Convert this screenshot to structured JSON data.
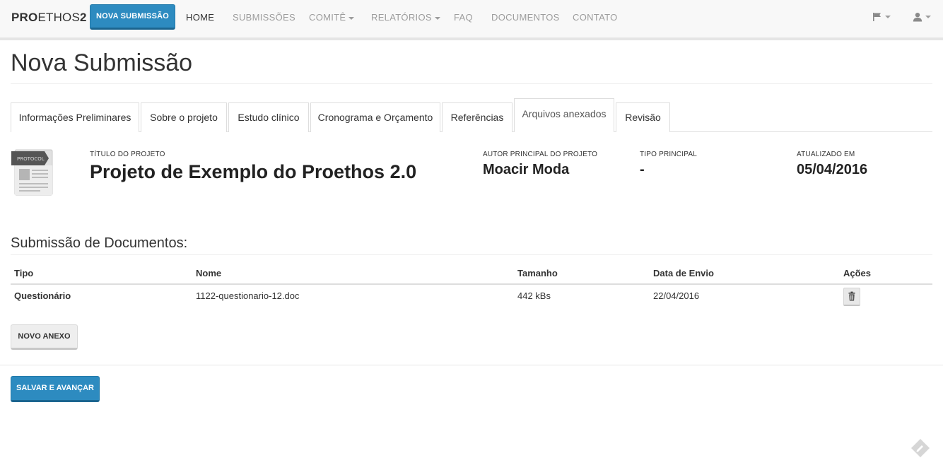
{
  "navbar": {
    "brand_bold": "PRO",
    "brand_light": "ETHOS",
    "brand_suffix": "2",
    "new_submission": "NOVA SUBMISSÃO",
    "items": [
      {
        "label": "HOME",
        "active": true
      },
      {
        "label": "SUBMISSÕES"
      },
      {
        "label": "COMITÊ"
      },
      {
        "label": "RELATÓRIOS"
      },
      {
        "label": "FAQ"
      },
      {
        "label": "DOCUMENTOS"
      },
      {
        "label": "CONTATO"
      }
    ],
    "right_icons": [
      "flag-icon",
      "user-icon"
    ]
  },
  "page": {
    "title": "Nova Submissão"
  },
  "tabs": [
    {
      "label": "Informações Preliminares"
    },
    {
      "label": "Sobre o projeto"
    },
    {
      "label": "Estudo clínico"
    },
    {
      "label": "Cronograma e Orçamento"
    },
    {
      "label": "Referências"
    },
    {
      "label": "Arquivos anexados",
      "active": true
    },
    {
      "label": "Revisão"
    }
  ],
  "project": {
    "icon_text": "PROTOCOL",
    "title_label": "TÍTULO DO PROJETO",
    "title": "Projeto de Exemplo do Proethos 2.0",
    "author_label": "AUTOR PRINCIPAL DO PROJETO",
    "author": "Moacir Moda",
    "type_label": "TIPO PRINCIPAL",
    "type": "-",
    "updated_label": "ATUALIZADO EM",
    "updated": "05/04/2016"
  },
  "documents": {
    "section_title": "Submissão de Documentos:",
    "columns": [
      "Tipo",
      "Nome",
      "Tamanho",
      "Data de Envio",
      "Ações"
    ],
    "rows": [
      {
        "tipo": "Questionário",
        "nome": "1122-questionario-12.doc",
        "tamanho": "442 kBs",
        "data": "22/04/2016"
      }
    ],
    "new_attachment": "NOVO ANEXO"
  },
  "actions": {
    "save_next": "SALVAR E AVANÇAR"
  },
  "colors": {
    "primary": "#2d8bc0",
    "navbar_bg": "#f8f8f8",
    "nav_text": "#9d9d9d"
  }
}
